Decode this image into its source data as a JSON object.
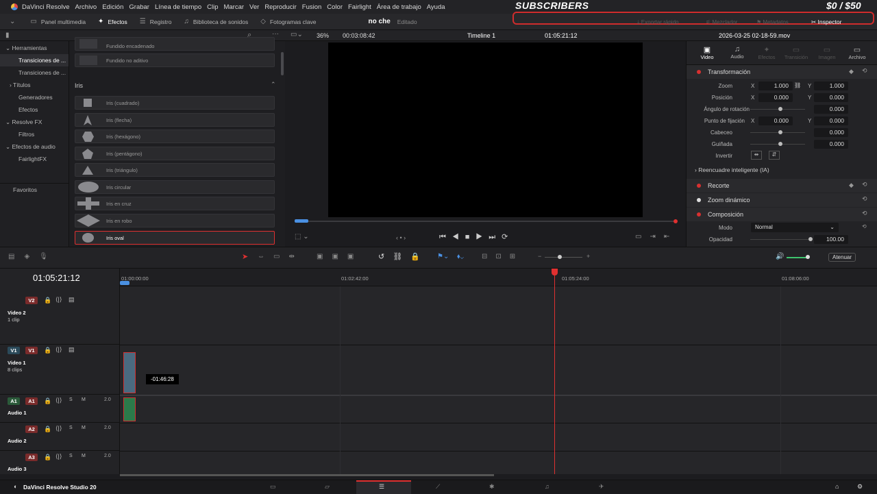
{
  "app": {
    "name": "DaVinci Resolve",
    "footer": "DaVinci Resolve Studio 20"
  },
  "overlay": {
    "subscribers": "SUBSCRIBERS",
    "money": "$0 / $50"
  },
  "menu": [
    "Archivo",
    "Edición",
    "Grabar",
    "Línea de tiempo",
    "Clip",
    "Marcar",
    "Ver",
    "Reproducir",
    "Fusion",
    "Color",
    "Fairlight",
    "Área de trabajo",
    "Ayuda"
  ],
  "toolbar": {
    "media": "Panel multimedia",
    "effects": "Efectos",
    "log": "Registro",
    "sound": "Biblioteca de sonidos",
    "keyframes": "Fotogramas clave",
    "project": "no che",
    "edited": "Editado",
    "quickexport": "Exportar rápido",
    "mixer": "Mezclador",
    "metadata": "Metadatos",
    "inspector": "Inspector"
  },
  "viewer": {
    "zoom": "36%",
    "duration": "00:03:08:42",
    "timeline": "Timeline 1",
    "timecode": "01:05:21:12",
    "file": "2026-03-25 02-18-59.mov"
  },
  "left": {
    "items": [
      "Herramientas",
      "Transiciones de ...",
      "Transiciones de ...",
      "Títulos",
      "Generadores",
      "Efectos",
      "Resolve FX",
      "Filtros",
      "Efectos de audio",
      "FairlightFX",
      "Favoritos"
    ]
  },
  "effects": {
    "top1": "Fundido encadenado",
    "top2": "Fundido no aditivo",
    "group": "Iris",
    "items": [
      "Iris (cuadrado)",
      "Iris (flecha)",
      "Iris (hexágono)",
      "Iris (pentágono)",
      "Iris (triángulo)",
      "Iris circular",
      "Iris en cruz",
      "Iris en robo",
      "Iris oval"
    ]
  },
  "inspector": {
    "tabs": [
      "Video",
      "Audio",
      "Efectos",
      "Transición",
      "Imagen",
      "Archivo"
    ],
    "transform": "Transformación",
    "rows": [
      {
        "k": "Zoom",
        "x": "1.000",
        "y": "1.000"
      },
      {
        "k": "Posición",
        "x": "0.000",
        "y": "0.000"
      },
      {
        "k": "Ángulo de rotación",
        "v": "0.000"
      },
      {
        "k": "Punto de fijación",
        "x": "0.000",
        "y": "0.000"
      },
      {
        "k": "Cabeceo",
        "v": "0.000"
      },
      {
        "k": "Guiñada",
        "v": "0.000"
      },
      {
        "k": "Invertir"
      }
    ],
    "smart": "Reencuadre inteligente (IA)",
    "crop": "Recorte",
    "dynzoom": "Zoom dinámico",
    "comp": "Composición",
    "mode_k": "Modo",
    "mode_v": "Normal",
    "opacity_k": "Opacidad",
    "opacity_v": "100.00"
  },
  "timeline": {
    "timecode": "01:05:21:12",
    "ticks": [
      "01:00:00:00",
      "01:02:42:00",
      "01:05:24:00",
      "01:08:06:00"
    ],
    "tooltip": "-01:46:28",
    "attenuate": "Atenuar",
    "tracks": [
      {
        "id": "V2",
        "name": "Video 2",
        "sub": "1 clip"
      },
      {
        "id": "V1",
        "name": "Video 1",
        "sub": "8 clips"
      },
      {
        "id": "A1",
        "name": "Audio 1",
        "vol": "2.0"
      },
      {
        "id": "A2",
        "name": "Audio 2",
        "vol": "2.0"
      },
      {
        "id": "A3",
        "name": "Audio 3",
        "vol": "2.0"
      }
    ]
  }
}
